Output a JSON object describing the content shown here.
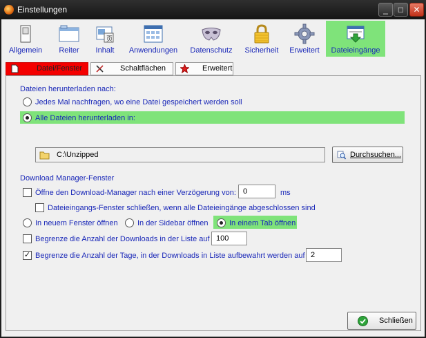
{
  "window": {
    "title": "Einstellungen",
    "minimize": "_",
    "maximize": "□",
    "close": "✕"
  },
  "toolbar": {
    "items": [
      {
        "label": "Allgemein",
        "icon": "switch-icon"
      },
      {
        "label": "Reiter",
        "icon": "window-icon"
      },
      {
        "label": "Inhalt",
        "icon": "content-icon"
      },
      {
        "label": "Anwendungen",
        "icon": "applications-icon"
      },
      {
        "label": "Datenschutz",
        "icon": "mask-icon"
      },
      {
        "label": "Sicherheit",
        "icon": "lock-icon"
      },
      {
        "label": "Erweitert",
        "icon": "gear-icon"
      },
      {
        "label": "Dateieingänge",
        "icon": "download-icon",
        "active": true
      }
    ]
  },
  "subtabs": [
    {
      "label": "Datei/Fenster",
      "icon": "document-icon",
      "active": true
    },
    {
      "label": "Schaltflächen",
      "icon": "tools-icon"
    },
    {
      "label": "Erweitert",
      "icon": "star-icon"
    }
  ],
  "download_location": {
    "group_label": "Dateien herunterladen nach:",
    "ask_option": "Jedes Mal nachfragen, wo eine Datei gespeichert werden soll",
    "all_option": "Alle Dateien herunterladen in:",
    "selected": "all",
    "path": "C:\\Unzipped",
    "browse_button": "Durchsuchen..."
  },
  "download_manager": {
    "group_label": "Download Manager-Fenster",
    "open_delay_label": "Öffne den Download-Manager nach einer Verzögerung von:",
    "open_delay_checked": false,
    "open_delay_value": "0",
    "open_delay_unit": "ms",
    "close_when_done_label": "Dateieingangs-Fenster schließen, wenn alle Dateieingänge abgeschlossen sind",
    "close_when_done_checked": false,
    "open_new_window": "In neuem Fenster öffnen",
    "open_sidebar": "In der Sidebar öffnen",
    "open_tab": "In einem Tab öffnen",
    "open_mode_selected": "tab",
    "limit_downloads_label": "Begrenze die Anzahl der Downloads in der Liste auf",
    "limit_downloads_checked": false,
    "limit_downloads_value": "100",
    "limit_days_label": "Begrenze die Anzahl der Tage, in der Downloads in Liste aufbewahrt werden auf",
    "limit_days_checked": true,
    "limit_days_value": "2"
  },
  "footer": {
    "close_button": "Schließen"
  },
  "colors": {
    "highlight": "#7fe37a",
    "active_subtab": "#f40000",
    "label_blue": "#1a28b8"
  }
}
